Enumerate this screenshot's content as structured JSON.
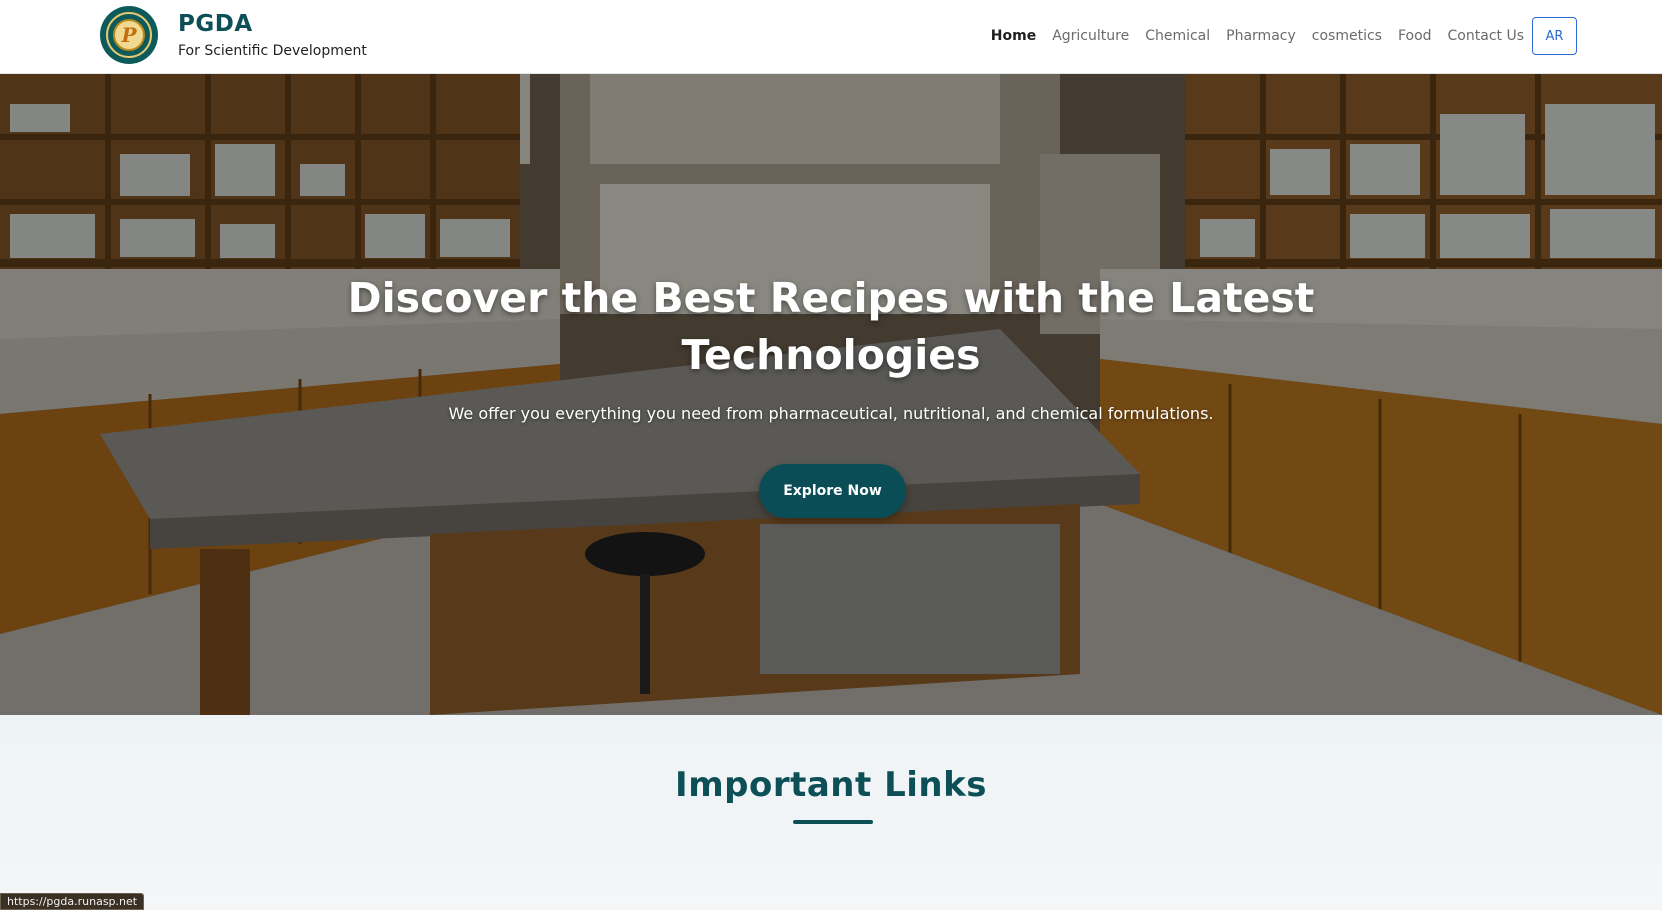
{
  "brand": {
    "logo_icon": "pgda-logo-icon",
    "logo_letter": "P",
    "title": "PGDA",
    "subtitle": "For Scientific Development"
  },
  "nav": {
    "items": [
      {
        "label": "Home",
        "active": true
      },
      {
        "label": "Agriculture",
        "active": false
      },
      {
        "label": "Chemical",
        "active": false
      },
      {
        "label": "Pharmacy",
        "active": false
      },
      {
        "label": "cosmetics",
        "active": false
      },
      {
        "label": "Food",
        "active": false
      },
      {
        "label": "Contact Us",
        "active": false
      }
    ],
    "lang_button": "AR"
  },
  "hero": {
    "background": "laboratory-photo",
    "title": "Discover the Best Recipes with the Latest Technologies",
    "subtitle": "We offer you everything you need from pharmaceutical, nutritional, and chemical formulations.",
    "cta_label": "Explore Now"
  },
  "links_section": {
    "title": "Important Links"
  },
  "status_bar": {
    "url": "https://pgda.runasp.net"
  },
  "colors": {
    "brand_teal": "#0d4f56",
    "button_teal": "#0a4d56",
    "lang_blue": "#2a6ad2"
  }
}
